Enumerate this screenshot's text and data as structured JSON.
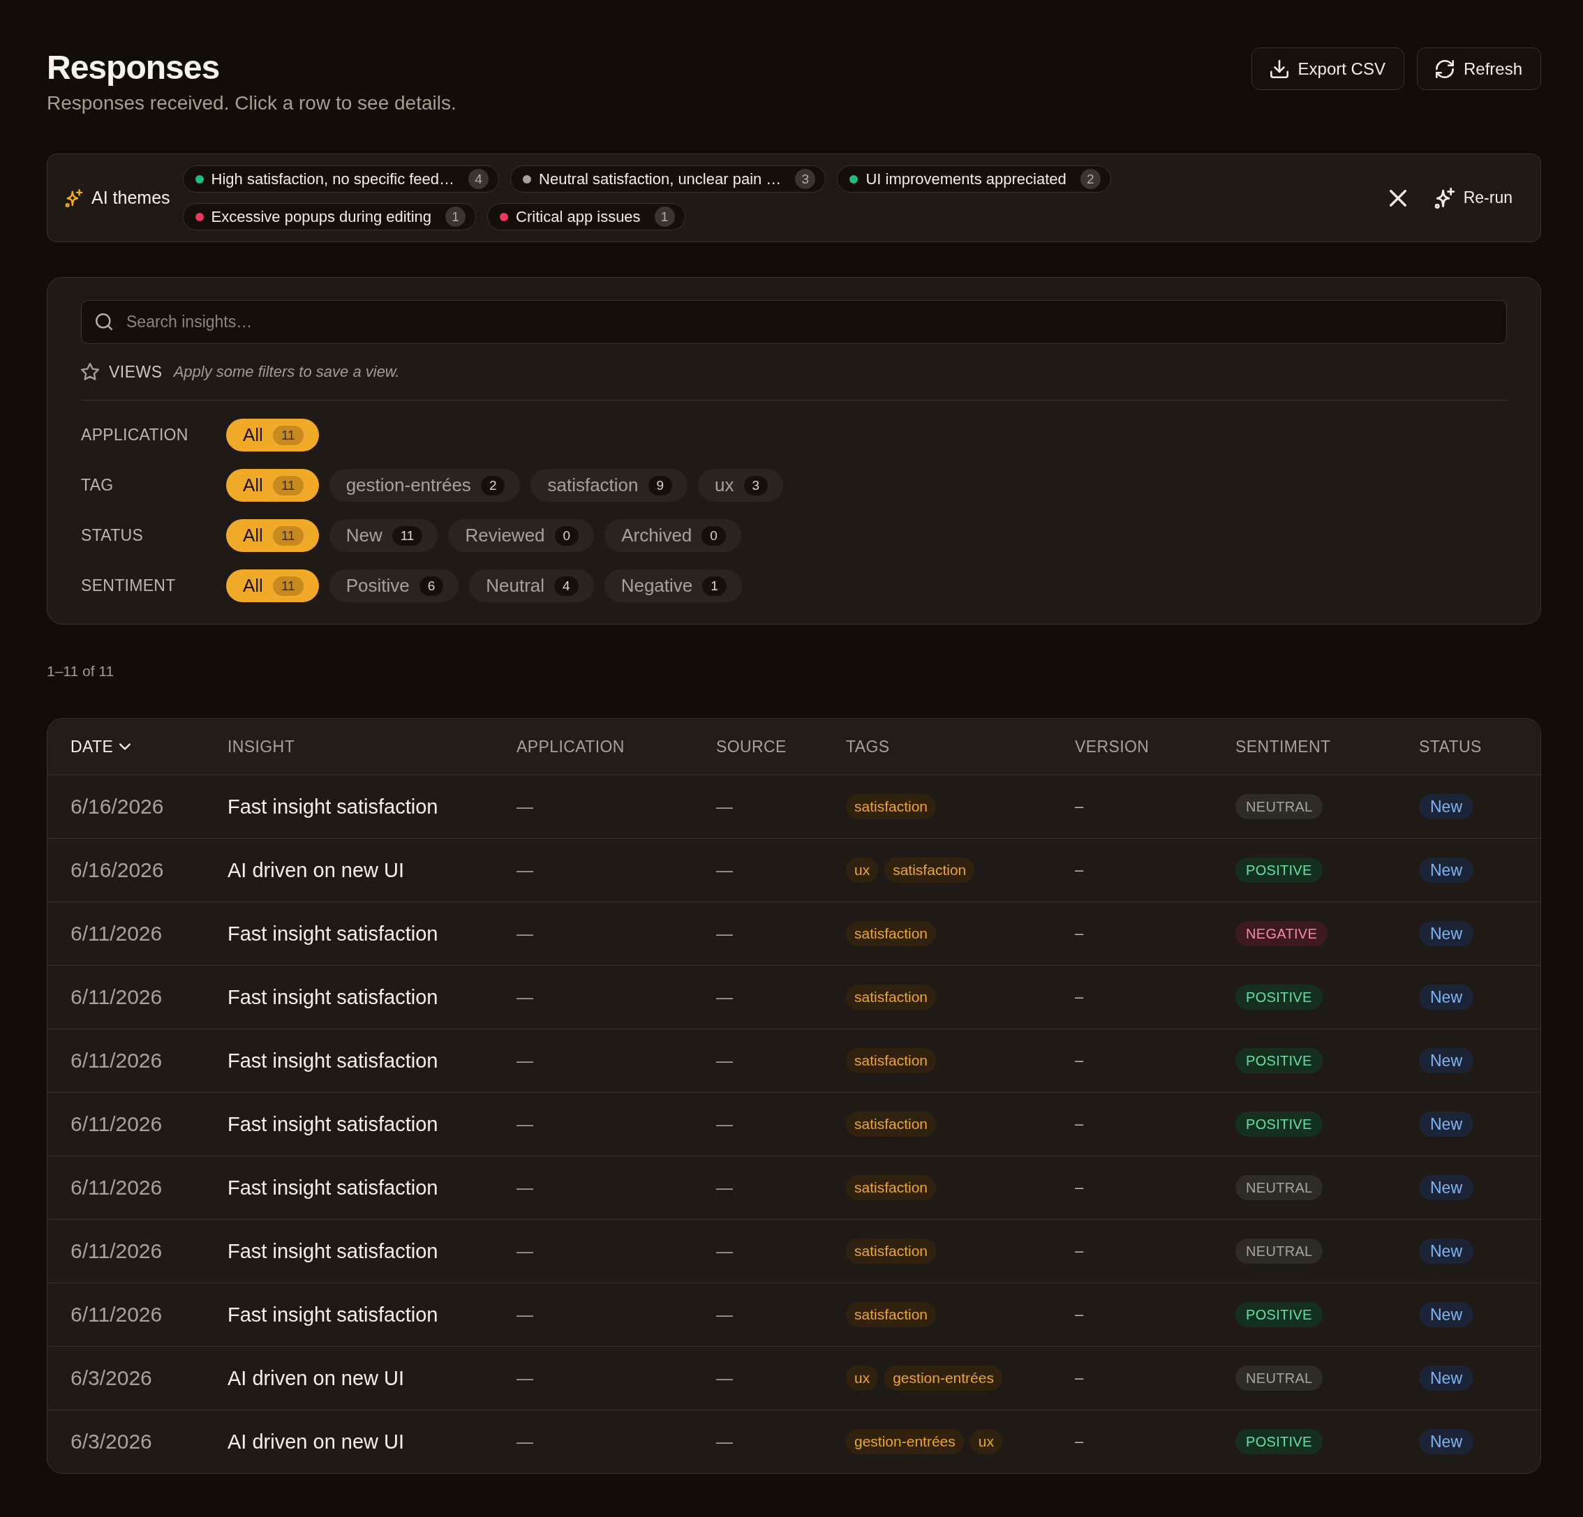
{
  "header": {
    "title": "Responses",
    "subtitle": "Responses received. Click a row to see details.",
    "actions": [
      {
        "label": "Export CSV",
        "kind": "export"
      },
      {
        "label": "Refresh",
        "kind": "refresh"
      }
    ]
  },
  "ai_themes": {
    "label": "AI themes",
    "themes": [
      {
        "label": "High satisfaction, no specific feed…",
        "count": "4",
        "color": "#1fbf7a"
      },
      {
        "label": "Neutral satisfaction, unclear pain …",
        "count": "3",
        "color": "#a8a29a"
      },
      {
        "label": "UI improvements appreciated",
        "count": "2",
        "color": "#1fbf7a"
      },
      {
        "label": "Excessive popups during editing",
        "count": "1",
        "color": "#f0365c"
      },
      {
        "label": "Critical app issues",
        "count": "1",
        "color": "#f0365c"
      }
    ],
    "rerun_label": "Re-run"
  },
  "filters": {
    "search": {
      "placeholder": "Search insights…"
    },
    "views": {
      "label": "VIEWS",
      "hint": "Apply some filters to save a view."
    },
    "groups": [
      {
        "label": "APPLICATION",
        "options": [
          {
            "label": "All",
            "count": "11",
            "selected": true
          }
        ]
      },
      {
        "label": "TAG",
        "options": [
          {
            "label": "All",
            "count": "11",
            "selected": true
          },
          {
            "label": "gestion-entrées",
            "count": "2",
            "selected": false
          },
          {
            "label": "satisfaction",
            "count": "9",
            "selected": false
          },
          {
            "label": "ux",
            "count": "3",
            "selected": false
          }
        ]
      },
      {
        "label": "STATUS",
        "options": [
          {
            "label": "All",
            "count": "11",
            "selected": true
          },
          {
            "label": "New",
            "count": "11",
            "selected": false
          },
          {
            "label": "Reviewed",
            "count": "0",
            "selected": false
          },
          {
            "label": "Archived",
            "count": "0",
            "selected": false
          }
        ]
      },
      {
        "label": "SENTIMENT",
        "options": [
          {
            "label": "All",
            "count": "11",
            "selected": true
          },
          {
            "label": "Positive",
            "count": "6",
            "selected": false
          },
          {
            "label": "Neutral",
            "count": "4",
            "selected": false
          },
          {
            "label": "Negative",
            "count": "1",
            "selected": false
          }
        ]
      }
    ]
  },
  "pagination": "1–11 of 11",
  "table": {
    "columns": [
      {
        "label": "DATE",
        "sorted": true
      },
      {
        "label": "INSIGHT",
        "sorted": false
      },
      {
        "label": "APPLICATION",
        "sorted": false
      },
      {
        "label": "SOURCE",
        "sorted": false
      },
      {
        "label": "TAGS",
        "sorted": false
      },
      {
        "label": "VERSION",
        "sorted": false
      },
      {
        "label": "SENTIMENT",
        "sorted": false
      },
      {
        "label": "STATUS",
        "sorted": false
      }
    ],
    "rows": [
      {
        "date": "6/16/2026",
        "insight": "Fast insight satisfaction",
        "application": "—",
        "source": "—",
        "tags": [
          "satisfaction"
        ],
        "version": "–",
        "sentiment": {
          "label": "NEUTRAL",
          "kind": "neutral"
        },
        "status": "New"
      },
      {
        "date": "6/16/2026",
        "insight": "AI driven on new UI",
        "application": "—",
        "source": "—",
        "tags": [
          "ux",
          "satisfaction"
        ],
        "version": "–",
        "sentiment": {
          "label": "POSITIVE",
          "kind": "positive"
        },
        "status": "New"
      },
      {
        "date": "6/11/2026",
        "insight": "Fast insight satisfaction",
        "application": "—",
        "source": "—",
        "tags": [
          "satisfaction"
        ],
        "version": "–",
        "sentiment": {
          "label": "NEGATIVE",
          "kind": "negative"
        },
        "status": "New"
      },
      {
        "date": "6/11/2026",
        "insight": "Fast insight satisfaction",
        "application": "—",
        "source": "—",
        "tags": [
          "satisfaction"
        ],
        "version": "–",
        "sentiment": {
          "label": "POSITIVE",
          "kind": "positive"
        },
        "status": "New"
      },
      {
        "date": "6/11/2026",
        "insight": "Fast insight satisfaction",
        "application": "—",
        "source": "—",
        "tags": [
          "satisfaction"
        ],
        "version": "–",
        "sentiment": {
          "label": "POSITIVE",
          "kind": "positive"
        },
        "status": "New"
      },
      {
        "date": "6/11/2026",
        "insight": "Fast insight satisfaction",
        "application": "—",
        "source": "—",
        "tags": [
          "satisfaction"
        ],
        "version": "–",
        "sentiment": {
          "label": "POSITIVE",
          "kind": "positive"
        },
        "status": "New"
      },
      {
        "date": "6/11/2026",
        "insight": "Fast insight satisfaction",
        "application": "—",
        "source": "—",
        "tags": [
          "satisfaction"
        ],
        "version": "–",
        "sentiment": {
          "label": "NEUTRAL",
          "kind": "neutral"
        },
        "status": "New"
      },
      {
        "date": "6/11/2026",
        "insight": "Fast insight satisfaction",
        "application": "—",
        "source": "—",
        "tags": [
          "satisfaction"
        ],
        "version": "–",
        "sentiment": {
          "label": "NEUTRAL",
          "kind": "neutral"
        },
        "status": "New"
      },
      {
        "date": "6/11/2026",
        "insight": "Fast insight satisfaction",
        "application": "—",
        "source": "—",
        "tags": [
          "satisfaction"
        ],
        "version": "–",
        "sentiment": {
          "label": "POSITIVE",
          "kind": "positive"
        },
        "status": "New"
      },
      {
        "date": "6/3/2026",
        "insight": "AI driven on new UI",
        "application": "—",
        "source": "—",
        "tags": [
          "ux",
          "gestion-entrées"
        ],
        "version": "–",
        "sentiment": {
          "label": "NEUTRAL",
          "kind": "neutral"
        },
        "status": "New"
      },
      {
        "date": "6/3/2026",
        "insight": "AI driven on new UI",
        "application": "—",
        "source": "—",
        "tags": [
          "gestion-entrées",
          "ux"
        ],
        "version": "–",
        "sentiment": {
          "label": "POSITIVE",
          "kind": "positive"
        },
        "status": "New"
      }
    ]
  }
}
